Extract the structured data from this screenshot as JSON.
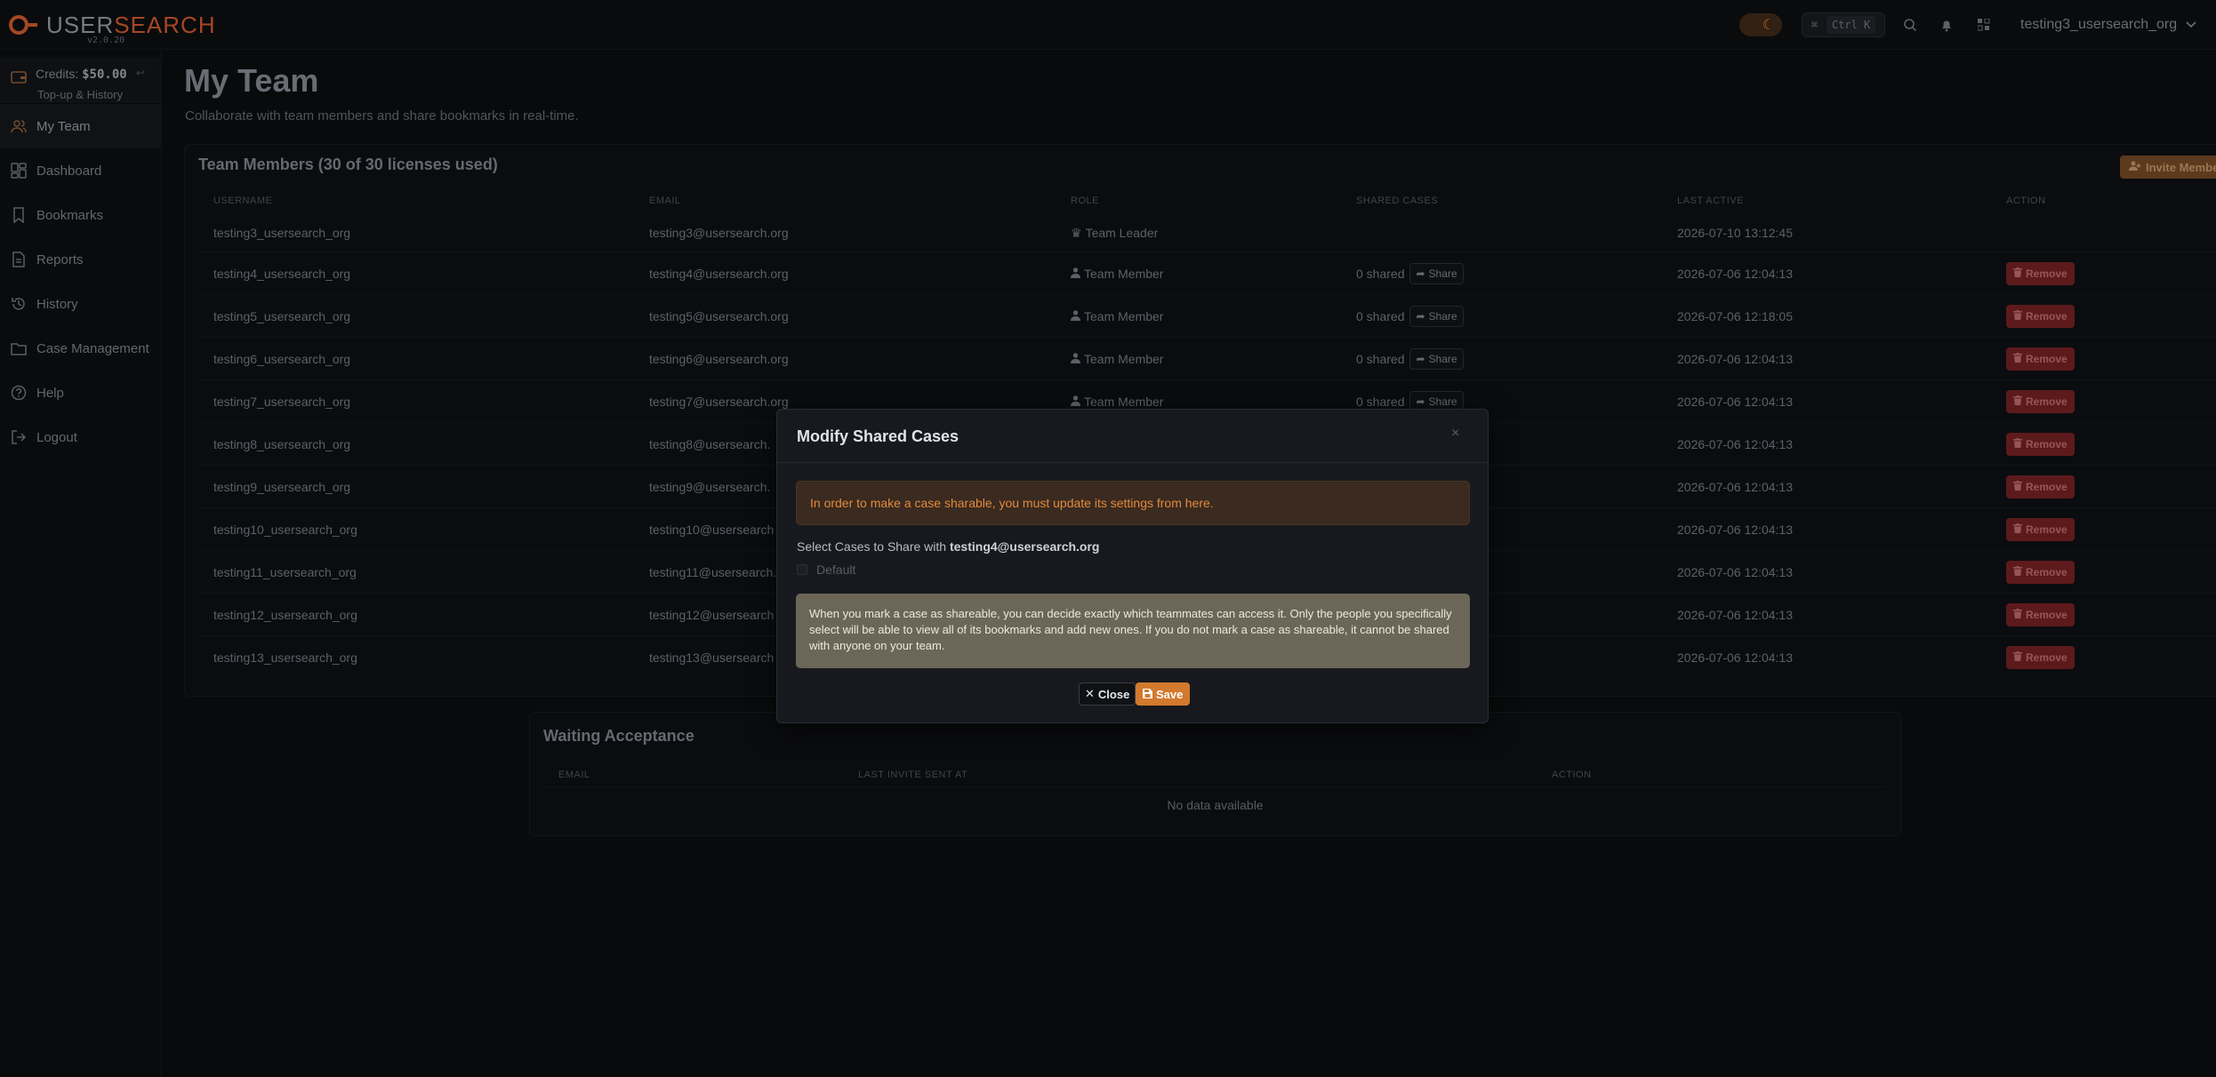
{
  "app": {
    "logo_user": "USER",
    "logo_search": "SEARCH",
    "version": "v2.0.20",
    "kbd_symbol": "⌘",
    "kbd_shortcut": "Ctrl K",
    "username": "testing3_usersearch_org",
    "accent_color": "#d27a2e"
  },
  "sidebar": {
    "credits_label": "Credits: ",
    "credits_value": "$50.00",
    "credits_link": "Top-up & History",
    "items": [
      {
        "label": "My Team",
        "icon": "users-icon",
        "active": true
      },
      {
        "label": "Dashboard",
        "icon": "dashboard-icon"
      },
      {
        "label": "Bookmarks",
        "icon": "bookmark-icon"
      },
      {
        "label": "Reports",
        "icon": "report-icon"
      },
      {
        "label": "History",
        "icon": "history-icon"
      },
      {
        "label": "Case Management",
        "icon": "folder-icon"
      },
      {
        "label": "Help",
        "icon": "help-icon"
      },
      {
        "label": "Logout",
        "icon": "logout-icon"
      }
    ]
  },
  "page": {
    "title": "My Team",
    "subtitle": "Collaborate with team members and share bookmarks in real-time."
  },
  "team": {
    "title": "Team Members (30 of 30 licenses used)",
    "invite_label": "Invite Member",
    "columns": [
      "USERNAME",
      "EMAIL",
      "ROLE",
      "SHARED CASES",
      "LAST ACTIVE",
      "ACTION"
    ],
    "share_label": "Share",
    "remove_label": "Remove",
    "rows": [
      {
        "username": "testing3_usersearch_org",
        "email": "testing3@usersearch.org",
        "role": "Team Leader",
        "shared": "",
        "last_active": "2026-07-10 13:12:45"
      },
      {
        "username": "testing4_usersearch_org",
        "email": "testing4@usersearch.org",
        "role": "Team Member",
        "shared": "0 shared",
        "last_active": "2026-07-06 12:04:13"
      },
      {
        "username": "testing5_usersearch_org",
        "email": "testing5@usersearch.org",
        "role": "Team Member",
        "shared": "0 shared",
        "last_active": "2026-07-06 12:18:05"
      },
      {
        "username": "testing6_usersearch_org",
        "email": "testing6@usersearch.org",
        "role": "Team Member",
        "shared": "0 shared",
        "last_active": "2026-07-06 12:04:13"
      },
      {
        "username": "testing7_usersearch_org",
        "email": "testing7@usersearch.org",
        "role": "Team Member",
        "shared": "0 shared",
        "last_active": "2026-07-06 12:04:13"
      },
      {
        "username": "testing8_usersearch_org",
        "email": "testing8@usersearch.",
        "role": "",
        "shared": "",
        "last_active": "2026-07-06 12:04:13"
      },
      {
        "username": "testing9_usersearch_org",
        "email": "testing9@usersearch.",
        "role": "",
        "shared": "",
        "last_active": "2026-07-06 12:04:13"
      },
      {
        "username": "testing10_usersearch_org",
        "email": "testing10@usersearch",
        "role": "",
        "shared": "",
        "last_active": "2026-07-06 12:04:13"
      },
      {
        "username": "testing11_usersearch_org",
        "email": "testing11@usersearch.",
        "role": "",
        "shared": "",
        "last_active": "2026-07-06 12:04:13"
      },
      {
        "username": "testing12_usersearch_org",
        "email": "testing12@usersearch",
        "role": "",
        "shared": "",
        "last_active": "2026-07-06 12:04:13"
      },
      {
        "username": "testing13_usersearch_org",
        "email": "testing13@usersearch",
        "role": "",
        "shared": "",
        "last_active": "2026-07-06 12:04:13"
      }
    ]
  },
  "waiting": {
    "title": "Waiting Acceptance",
    "columns": [
      "EMAIL",
      "LAST INVITE SENT AT",
      "ACTION"
    ],
    "empty": "No data available"
  },
  "modal": {
    "title": "Modify Shared Cases",
    "close_x": "×",
    "warning": "In order to make a case sharable, you must update its settings from here.",
    "select_prefix": "Select Cases to Share with ",
    "select_email": "testing4@usersearch.org",
    "case_name": "Default",
    "info": "When you mark a case as shareable, you can decide exactly which teammates can access it. Only the people you specifically select will be able to view all of its bookmarks and add new ones. If you do not mark a case as shareable, it cannot be shared with anyone on your team.",
    "close_label": "Close",
    "save_label": "Save"
  }
}
